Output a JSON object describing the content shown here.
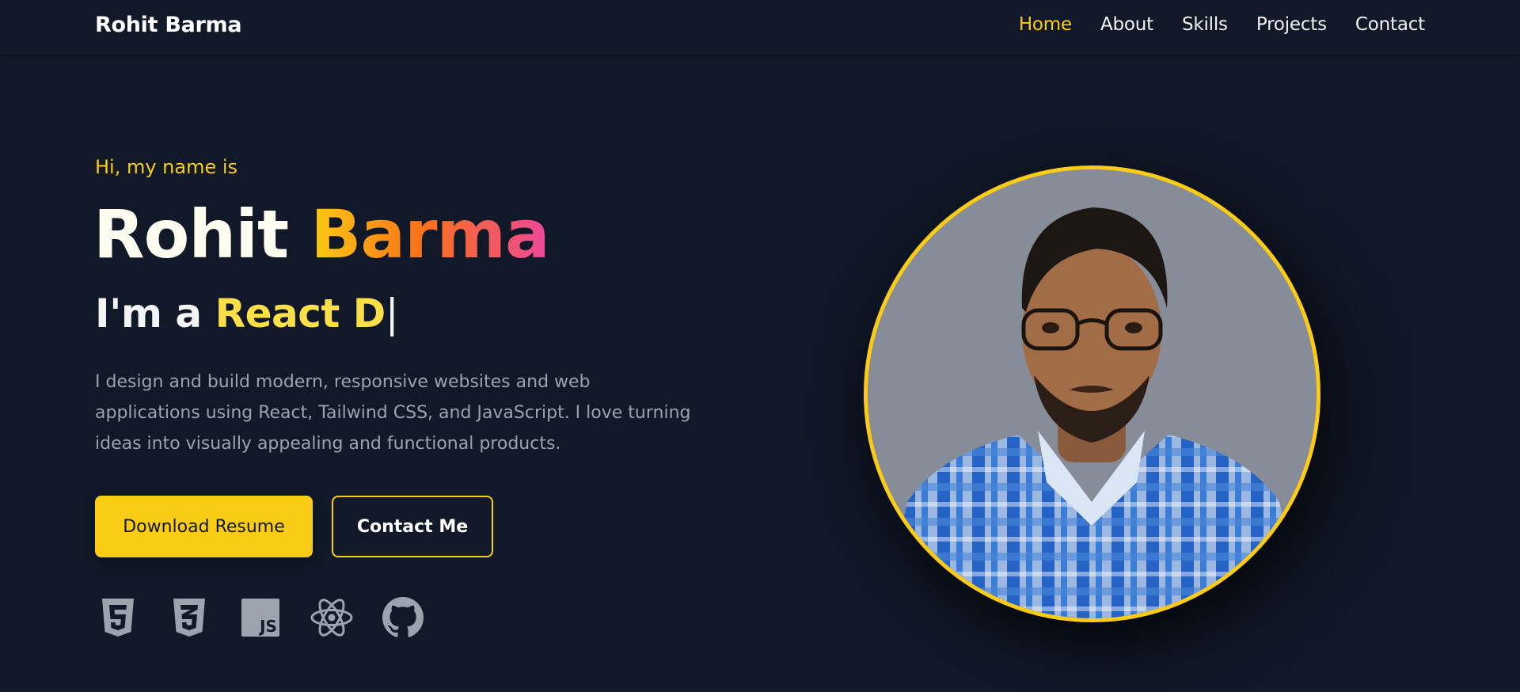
{
  "nav": {
    "brand": "Rohit Barma",
    "links": [
      {
        "label": "Home",
        "active": true
      },
      {
        "label": "About",
        "active": false
      },
      {
        "label": "Skills",
        "active": false
      },
      {
        "label": "Projects",
        "active": false
      },
      {
        "label": "Contact",
        "active": false
      }
    ]
  },
  "hero": {
    "greeting": "Hi, my name is",
    "first_name": "Rohit",
    "last_name": "Barma",
    "role_prefix": "I'm a",
    "role_typed": "React D",
    "cursor": "|",
    "bio": "I design and build modern, responsive websites and web applications using React, Tailwind CSS, and JavaScript. I love turning ideas into visually appealing and functional products.",
    "primary_button": "Download Resume",
    "secondary_button": "Contact Me",
    "tech_icons": [
      "html5-icon",
      "css3-icon",
      "javascript-icon",
      "react-icon",
      "github-icon"
    ]
  },
  "profile_photo": {
    "alt": "profile-photo"
  },
  "colors": {
    "background": "#111827",
    "accent": "#facc15",
    "muted_text": "#9ca3af",
    "icon_gray": "#9ca3af",
    "gradient": [
      "#facc15",
      "#f97316",
      "#ec4899"
    ]
  }
}
